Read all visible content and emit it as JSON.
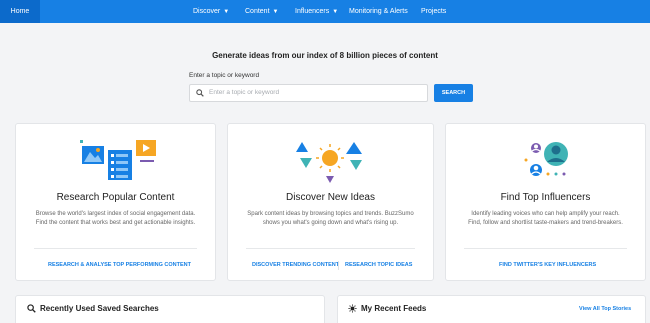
{
  "nav": {
    "home": "Home",
    "items": [
      {
        "label": "Discover",
        "has_dropdown": true
      },
      {
        "label": "Content",
        "has_dropdown": true
      },
      {
        "label": "Influencers",
        "has_dropdown": true
      },
      {
        "label": "Monitoring & Alerts",
        "has_dropdown": false
      },
      {
        "label": "Projects",
        "has_dropdown": false
      }
    ]
  },
  "search": {
    "headline": "Generate ideas from our index of 8 billion pieces of content",
    "label": "Enter a topic or keyword",
    "placeholder": "Enter a topic or keyword",
    "button": "SEARCH"
  },
  "cards": [
    {
      "title": "Research Popular Content",
      "description": "Browse the world's largest index of social engagement data. Find the content that works best and get actionable insights.",
      "links": [
        "RESEARCH & ANALYSE TOP PERFORMING CONTENT"
      ],
      "illustration_icon": "content-research-icon"
    },
    {
      "title": "Discover New Ideas",
      "description": "Spark content ideas by browsing topics and trends. BuzzSumo shows you what's going down and what's rising up.",
      "links": [
        "DISCOVER TRENDING CONTENT",
        "RESEARCH TOPIC IDEAS"
      ],
      "illustration_icon": "ideas-shapes-icon"
    },
    {
      "title": "Find Top Influencers",
      "description": "Identify leading voices who can help amplify your reach. Find, follow and shortlist taste-makers and trend-breakers.",
      "links": [
        "FIND TWITTER'S KEY INFLUENCERS"
      ],
      "illustration_icon": "influencers-avatars-icon"
    }
  ],
  "panels": {
    "saved_searches": {
      "title": "Recently Used Saved Searches",
      "icon": "search-icon"
    },
    "feeds": {
      "title": "My Recent Feeds",
      "icon": "sun-gear-icon",
      "link": "View All Top Stories"
    }
  },
  "colors": {
    "brand_blue": "#1780e4",
    "brand_blue_dark": "#0c6acb",
    "accent_orange": "#f6a623",
    "accent_teal": "#3fb3b5",
    "accent_purple": "#7b5bb0"
  }
}
